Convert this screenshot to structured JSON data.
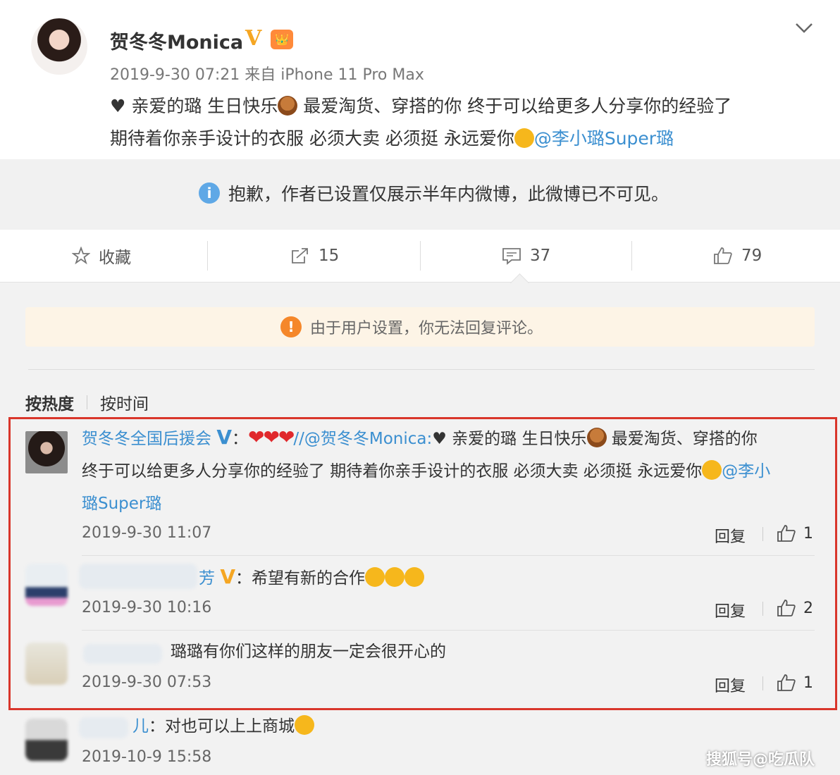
{
  "post": {
    "author": "贺冬冬Monica",
    "verified_badge": "V",
    "vip_badge": "👑",
    "meta": "2019-9-30 07:21 来自 iPhone 11 Pro Max",
    "content_a": "♥ 亲爱的璐 生日快乐",
    "content_b": " 最爱淘货、穿搭的你 终于可以给更多人分享你的经验了",
    "content_c": "期待着你亲手设计的衣服 必须大卖 必须挺 永远爱你",
    "mention": "@李小璐Super璐"
  },
  "notice": {
    "icon": "info-icon",
    "text": "抱歉，作者已设置仅展示半年内微博，此微博已不可见。"
  },
  "actions": {
    "favorite_label": "收藏",
    "repost_count": "15",
    "comment_count": "37",
    "like_count": "79"
  },
  "warning": {
    "icon": "warning-icon",
    "text": "由于用户设置，你无法回复评论。"
  },
  "sort": {
    "hot": "按热度",
    "time": "按时间"
  },
  "comments": [
    {
      "name": "贺冬冬全国后援会",
      "verified": "V",
      "text_a": "：",
      "hearts": "❤❤❤",
      "repost_mention": "//@贺冬冬Monica:",
      "text_b": "♥ 亲爱的璐 生日快乐",
      "text_c": " 最爱淘货、穿搭的你",
      "text_d": "终于可以给更多人分享你的经验了 期待着你亲手设计的衣服 必须大卖 必须挺 永远爱你",
      "mention_a": "@李小",
      "mention_b": "璐Super璐",
      "time": "2019-9-30 11:07",
      "reply": "回复",
      "likes": "1"
    },
    {
      "name_suffix": "芳",
      "verified": "V",
      "text": "：希望有新的合作",
      "time": "2019-9-30 10:16",
      "reply": "回复",
      "likes": "2"
    },
    {
      "text": "璐璐有你们这样的朋友一定会很开心的",
      "time": "2019-9-30 07:53",
      "reply": "回复",
      "likes": "1"
    },
    {
      "name_suffix": "儿",
      "text": "：对也可以上上商城",
      "time": "2019-10-9 15:58"
    }
  ],
  "watermark": "搜狐号@吃瓜队",
  "colors": {
    "link": "#3b8fd0",
    "highlight_border": "#d9362b",
    "verified": "#f5a623",
    "warning_bg": "#fdf4e6"
  }
}
